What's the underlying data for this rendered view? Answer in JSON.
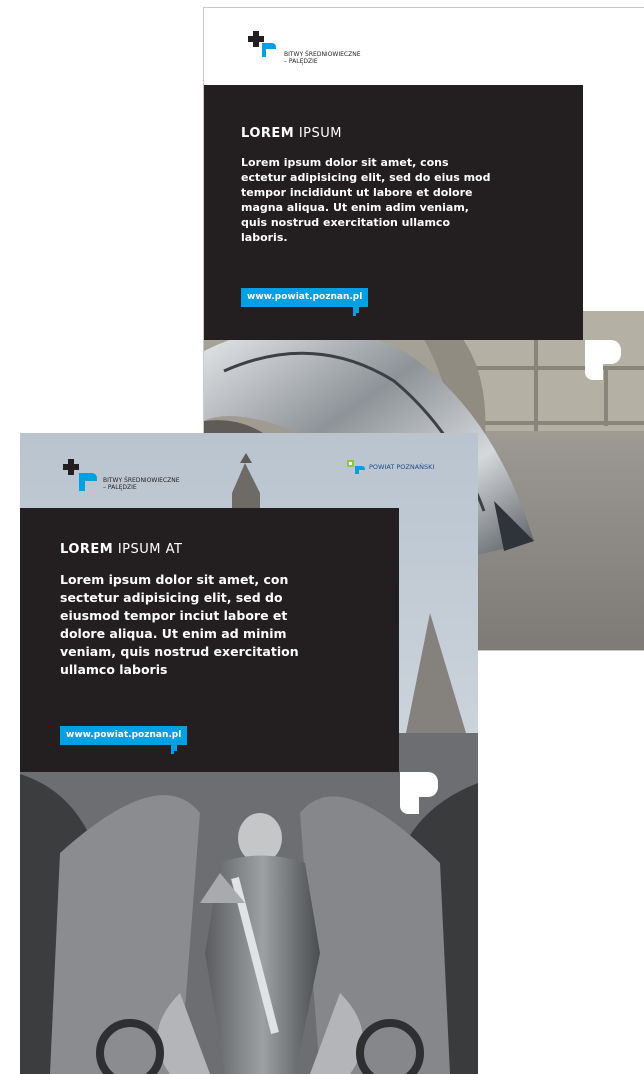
{
  "back": {
    "brand_line1": "BITWY ŚREDNIOWIECZNE",
    "brand_line2": "– PALĘDZIE",
    "heading_bold": "LOREM",
    "heading_light": "IPSUM",
    "body": "Lorem ipsum dolor sit amet, cons ectetur adipisicing elit, sed do eius mod tempor incididunt ut labore et dolore magna aliqua. Ut enim adim veniam, quis nostrud exercitation ullamco laboris.",
    "url": "www.powiat.poznan.pl"
  },
  "front": {
    "brand_line1": "BITWY ŚREDNIOWIECZNE",
    "brand_line2": "– PALĘDZIE",
    "partner": "POWIAT POZNAŃSKI",
    "heading_bold": "LOREM",
    "heading_light": "IPSUM AT",
    "body": "Lorem ipsum dolor sit amet, con sectetur adipisicing elit, sed do eiusmod tempor inciut labore et dolore aliqua. Ut enim ad minim veniam, quis nostrud exercitation ullamco laboris",
    "url": "www.powiat.poznan.pl"
  },
  "colors": {
    "panel": "#231f20",
    "accent": "#00a0e3",
    "partner_green": "#8dc63f"
  },
  "icons": [
    "cross-icon",
    "bracket-icon",
    "corner-mark-icon",
    "partner-logo-icon"
  ]
}
